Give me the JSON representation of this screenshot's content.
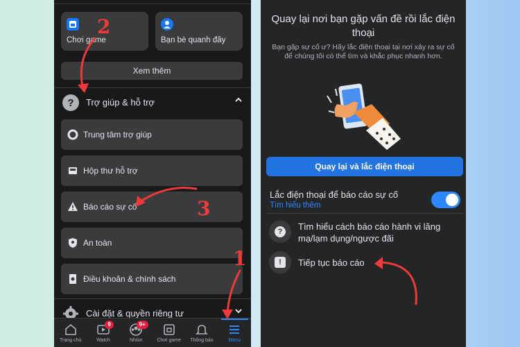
{
  "left": {
    "shortcuts": [
      {
        "label": "Chơi game",
        "icon": "game-icon"
      },
      {
        "label": "Bạn bè quanh đây",
        "icon": "nearby-friends-icon"
      }
    ],
    "see_more": "Xem thêm",
    "help_section": {
      "label": "Trợ giúp & hỗ trợ",
      "icon": "question-icon",
      "chevron": "chevron-up-icon"
    },
    "help_items": [
      {
        "label": "Trung tâm trợ giúp",
        "icon": "lifebuoy-icon"
      },
      {
        "label": "Hộp thư hỗ trợ",
        "icon": "inbox-icon"
      },
      {
        "label": "Báo cáo sự cố",
        "icon": "warning-icon"
      },
      {
        "label": "An toàn",
        "icon": "shield-icon"
      },
      {
        "label": "Điều khoản & chính sách",
        "icon": "policy-icon"
      }
    ],
    "settings_section": {
      "label": "Cài đặt & quyền riêng tư",
      "icon": "gear-icon",
      "chevron": "chevron-down-icon"
    },
    "bottom_nav": [
      {
        "label": "Trang chủ",
        "icon": "home-icon"
      },
      {
        "label": "Watch",
        "icon": "watch-icon",
        "badge": "9"
      },
      {
        "label": "Nhóm",
        "icon": "groups-icon",
        "badge": "9+"
      },
      {
        "label": "Chơi game",
        "icon": "gaming-icon"
      },
      {
        "label": "Thông báo",
        "icon": "bell-icon"
      },
      {
        "label": "Menu",
        "icon": "menu-icon"
      }
    ]
  },
  "right": {
    "title": "Quay lại nơi bạn gặp vấn đề rồi lắc điện thoại",
    "subtitle": "Bạn gặp sự cố ư? Hãy lắc điện thoại tại nơi xảy ra sự cố để chúng tôi có thể tìm và khắc phục nhanh hơn.",
    "primary_button": "Quay lại và lắc điện thoại",
    "toggle": {
      "label": "Lắc điện thoại để báo cáo sự cố",
      "link": "Tìm hiểu thêm",
      "on": true
    },
    "options": [
      {
        "label": "Tìm hiểu cách báo cáo hành vi lăng mạ/lạm dụng/ngược đãi",
        "icon": "question-icon",
        "glyph": "?"
      },
      {
        "label": "Tiếp tục báo cáo",
        "icon": "alert-icon",
        "glyph": "!"
      }
    ]
  },
  "annotations": {
    "step1": "1",
    "step2": "2",
    "step3": "3"
  },
  "colors": {
    "accent": "#2d88ff",
    "button": "#2374e1",
    "badge": "#e41e3f",
    "annotation": "#ee3a3a"
  }
}
